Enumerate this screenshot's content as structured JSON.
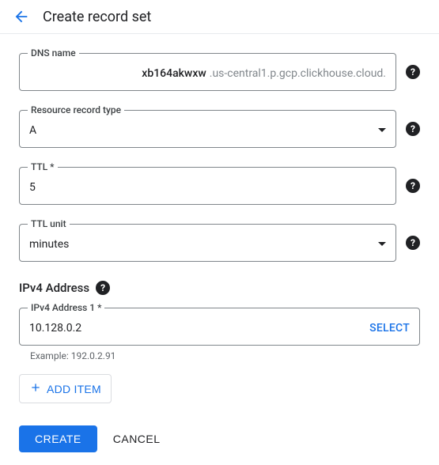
{
  "header": {
    "title": "Create record set"
  },
  "fields": {
    "dns": {
      "label": "DNS name",
      "value": "xb164akwxw",
      "suffix": ".us-central1.p.gcp.clickhouse.cloud."
    },
    "recordType": {
      "label": "Resource record type",
      "value": "A"
    },
    "ttl": {
      "label": "TTL *",
      "value": "5"
    },
    "ttlUnit": {
      "label": "TTL unit",
      "value": "minutes"
    }
  },
  "ipv4": {
    "sectionTitle": "IPv4 Address",
    "items": [
      {
        "label": "IPv4 Address 1 *",
        "value": "10.128.0.2",
        "selectLabel": "SELECT"
      }
    ],
    "hint": "Example: 192.0.2.91"
  },
  "buttons": {
    "addItem": "ADD ITEM",
    "create": "CREATE",
    "cancel": "CANCEL"
  }
}
